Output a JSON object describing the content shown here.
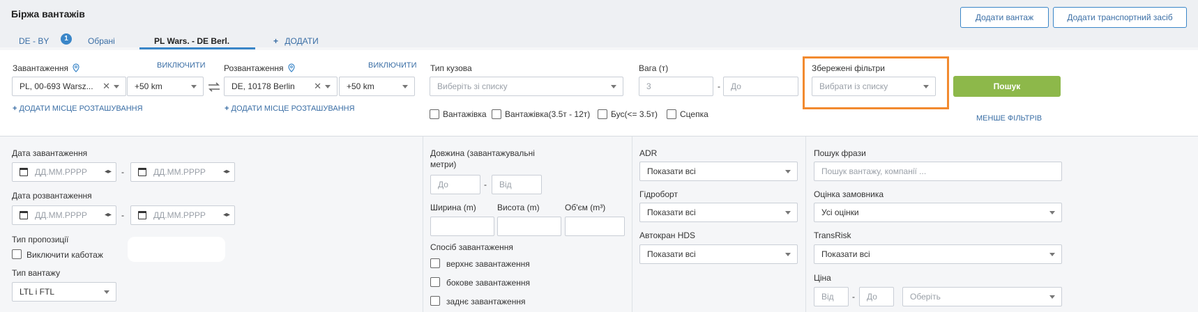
{
  "header": {
    "title": "Біржа вантажів",
    "tabs": [
      {
        "label": "DE - BY"
      },
      {
        "label": "Обрані"
      },
      {
        "label": "PL Wars. - DE Berl."
      },
      {
        "label": "ДОДАТИ"
      }
    ],
    "badge": "1",
    "add_cargo_label": "Додати вантаж",
    "add_vehicle_label": "Додати транспортний засіб"
  },
  "filters": {
    "loading": {
      "label": "Завантаження",
      "exclude_label": "ВИКЛЮЧИТИ",
      "location": "PL, 00-693 Warsz...",
      "radius": "+50 km",
      "add_label": "ДОДАТИ МІСЦЕ РОЗТАШУВАННЯ"
    },
    "unloading": {
      "label": "Розвантаження",
      "exclude_label": "ВИКЛЮЧИТИ",
      "location": "DE, 10178 Berlin",
      "radius": "+50 km",
      "add_label": "ДОДАТИ МІСЦЕ РОЗТАШУВАННЯ"
    },
    "body_type": {
      "label": "Тип кузова",
      "placeholder": "Виберіть зі списку",
      "options": [
        "Вантажівка",
        "Вантажівка(3.5т - 12т)",
        "Бус(<= 3.5т)",
        "Сцепка"
      ]
    },
    "weight": {
      "label": "Вага (т)",
      "from": "3",
      "to_placeholder": "До",
      "dash": "-"
    },
    "saved_filters": {
      "label": "Збережені фільтри",
      "placeholder": "Вибрати із списку"
    },
    "search_label": "Пошук",
    "less_filters_label": "МЕНШЕ ФІЛЬТРІВ"
  },
  "lower": {
    "loading_date": {
      "label": "Дата завантаження",
      "placeholder": "ДД.ММ.РРРР"
    },
    "unloading_date": {
      "label": "Дата розвантаження",
      "placeholder": "ДД.ММ.РРРР"
    },
    "offer_type": {
      "label": "Тип пропозиції",
      "cabotage_label": "Виключити каботаж"
    },
    "cargo_type": {
      "label": "Тип вантажу",
      "value": "LTL і FTL"
    },
    "length": {
      "label_line1": "Довжина (завантажувальні",
      "label_line2": "метри)",
      "from_placeholder": "До",
      "to_placeholder": "Від"
    },
    "width_label": "Ширина (m)",
    "height_label": "Висота (m)",
    "volume_label": "Об'єм (m³)",
    "loading_method": {
      "label": "Спосіб завантаження",
      "options": [
        "верхнє завантаження",
        "бокове завантаження",
        "заднє завантаження"
      ]
    },
    "adr": {
      "label": "ADR",
      "value": "Показати всі"
    },
    "hydroboard": {
      "label": "Гідроборт",
      "value": "Показати всі"
    },
    "crane": {
      "label": "Автокран HDS",
      "value": "Показати всі"
    },
    "phrase": {
      "label": "Пошук фрази",
      "placeholder": "Пошук вантажу, компанії ..."
    },
    "rating": {
      "label": "Оцінка замовника",
      "value": "Усі оцінки"
    },
    "transrisk": {
      "label": "TransRisk",
      "value": "Показати всі"
    },
    "price": {
      "label": "Ціна",
      "from_placeholder": "Від",
      "to_placeholder": "До",
      "currency_placeholder": "Оберіть"
    }
  },
  "colors": {
    "accent": "#3a86c8",
    "search": "#8db84a",
    "highlight": "#f28a2f"
  }
}
